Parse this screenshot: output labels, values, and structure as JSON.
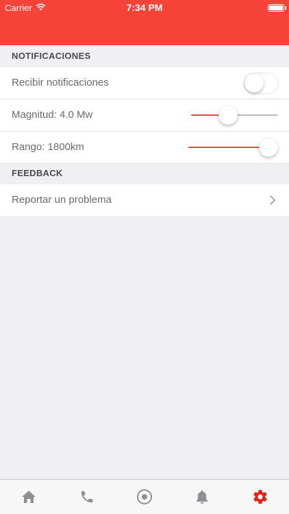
{
  "status_bar": {
    "carrier": "Carrier",
    "time": "7:34 PM"
  },
  "colors": {
    "accent": "#f7443a",
    "tab_inactive": "#8e8e93",
    "tab_active": "#e2231a"
  },
  "sections": {
    "notifications": {
      "title": "NOTIFICACIONES",
      "receive_label": "Recibir notificaciones",
      "receive_enabled": false,
      "magnitude_label": "Magnitud: 4.0 Mw",
      "magnitude_level": 0.4,
      "range_label": "Rango: 1800km",
      "range_level": 1.0
    },
    "feedback": {
      "title": "FEEDBACK",
      "report_label": "Reportar un problema"
    }
  },
  "tab_bar": {
    "tabs": [
      {
        "icon": "home-icon",
        "active": false
      },
      {
        "icon": "phone-icon",
        "active": false
      },
      {
        "icon": "target-icon",
        "active": false
      },
      {
        "icon": "bell-icon",
        "active": false
      },
      {
        "icon": "gear-icon",
        "active": true
      }
    ]
  }
}
